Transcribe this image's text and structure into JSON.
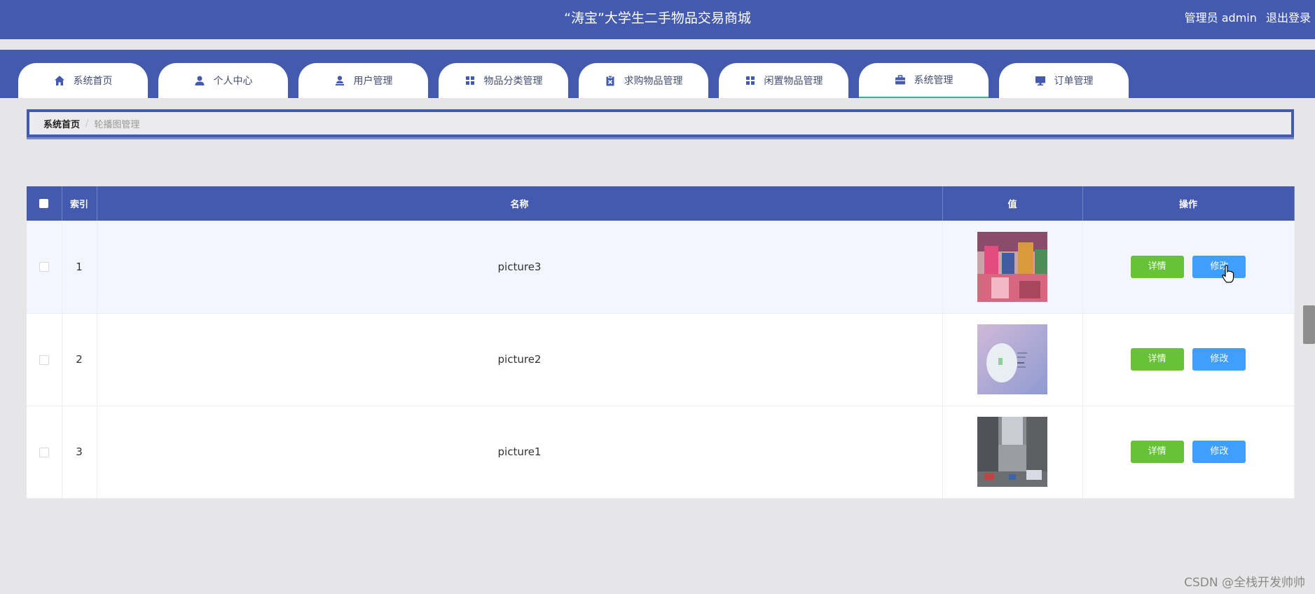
{
  "header": {
    "title": "“涛宝”大学生二手物品交易商城",
    "user_label": "管理员 admin",
    "logout_label": "退出登录"
  },
  "nav": {
    "tabs": [
      {
        "label": "系统首页",
        "icon": "home-icon"
      },
      {
        "label": "个人中心",
        "icon": "person-icon"
      },
      {
        "label": "用户管理",
        "icon": "user-manage-icon"
      },
      {
        "label": "物品分类管理",
        "icon": "grid-icon"
      },
      {
        "label": "求购物品管理",
        "icon": "clipboard-icon"
      },
      {
        "label": "闲置物品管理",
        "icon": "grid-icon"
      },
      {
        "label": "系统管理",
        "icon": "briefcase-icon"
      },
      {
        "label": "订单管理",
        "icon": "monitor-icon"
      }
    ],
    "active_index": 6
  },
  "breadcrumb": {
    "home": "系统首页",
    "separator": "/",
    "current": "轮播图管理"
  },
  "table": {
    "columns": [
      "索引",
      "名称",
      "值",
      "操作"
    ],
    "rows": [
      {
        "index": "1",
        "name": "picture3",
        "value_image": "crowd-market-thumbnail"
      },
      {
        "index": "2",
        "name": "picture2",
        "value_image": "purple-banner-thumbnail"
      },
      {
        "index": "3",
        "name": "picture1",
        "value_image": "street-scene-thumbnail"
      }
    ],
    "detail_label": "详情",
    "edit_label": "修改"
  },
  "watermark": "CSDN @全栈开发帅帅",
  "colors": {
    "primary": "#445aae",
    "detail_button": "#67c23a",
    "edit_button": "#409eff"
  }
}
